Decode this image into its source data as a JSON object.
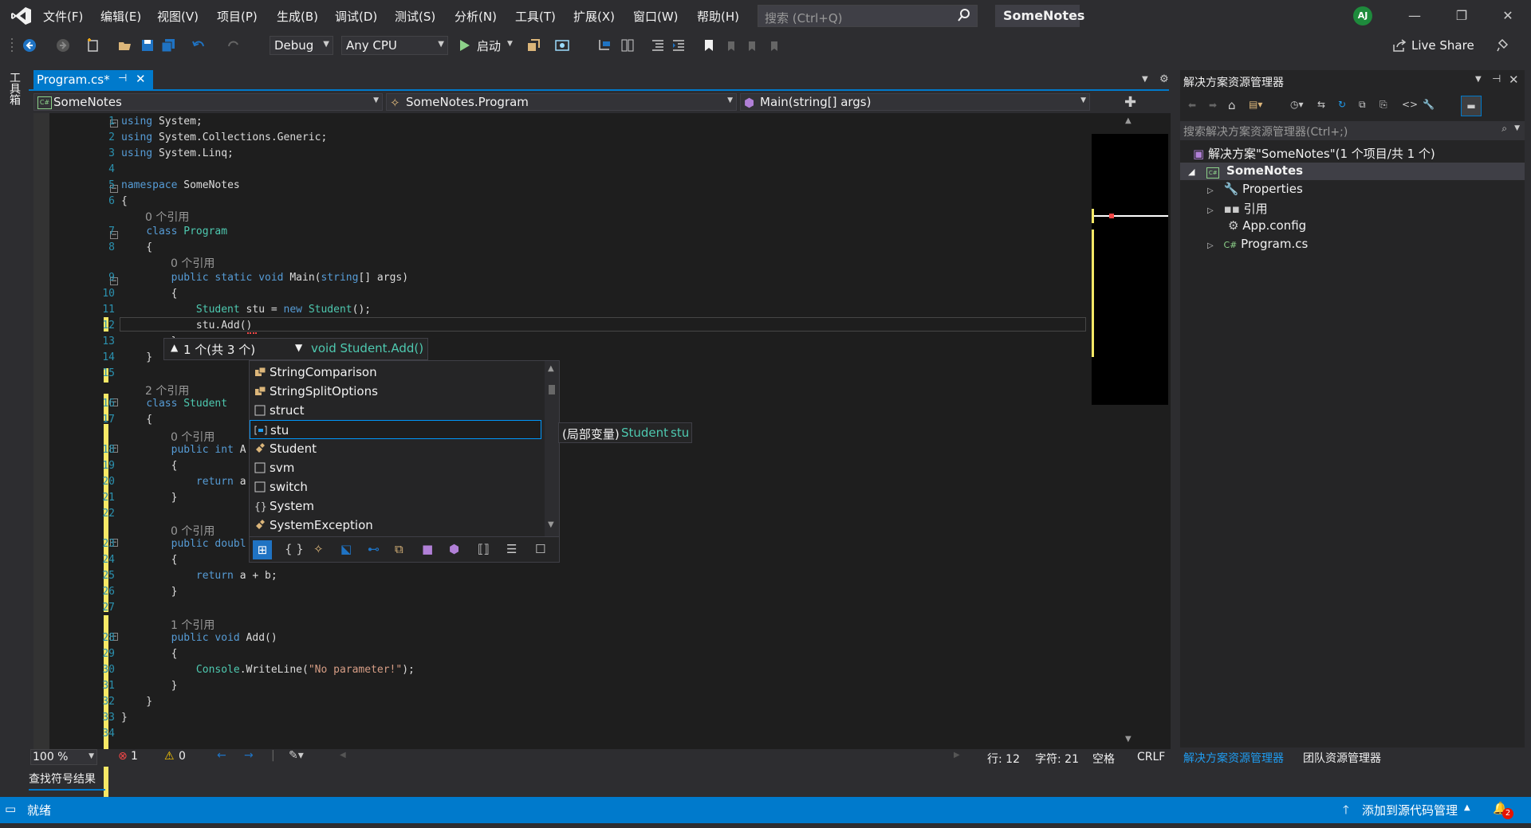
{
  "menu": [
    "文件(F)",
    "编辑(E)",
    "视图(V)",
    "项目(P)",
    "生成(B)",
    "调试(D)",
    "测试(S)",
    "分析(N)",
    "工具(T)",
    "扩展(X)",
    "窗口(W)",
    "帮助(H)"
  ],
  "search": {
    "placeholder": "搜索 (Ctrl+Q)"
  },
  "app_title": "SomeNotes",
  "avatar_initials": "AJ",
  "toolbar": {
    "config": "Debug",
    "platform": "Any CPU",
    "start_label": "启动",
    "live_share": "Live Share"
  },
  "toolbox_label": "工具箱",
  "tab": {
    "label": "Program.cs*"
  },
  "nav": {
    "project": "SomeNotes",
    "class": "SomeNotes.Program",
    "member": "Main(string[] args)"
  },
  "code_lines": [
    {
      "n": "1",
      "html": "<span class='kw'>using</span> System;"
    },
    {
      "n": "2",
      "html": "<span class='kw'>using</span> System.Collections.Generic;"
    },
    {
      "n": "3",
      "html": "<span class='kw'>using</span> System.Linq;"
    },
    {
      "n": "4",
      "html": ""
    },
    {
      "n": "5",
      "html": "<span class='kw'>namespace</span> SomeNotes"
    },
    {
      "n": "6",
      "html": "{"
    },
    {
      "n": "7",
      "html": "    <span class='kw'>class</span> <span class='ty'>Program</span>"
    },
    {
      "n": "8",
      "html": "    {"
    },
    {
      "n": "9",
      "html": "        <span class='kw'>public static void</span> Main(<span class='kw'>string</span>[] args)"
    },
    {
      "n": "10",
      "html": "        {"
    },
    {
      "n": "11",
      "html": "            <span class='ty'>Student</span> stu = <span class='kw'>new</span> <span class='ty'>Student</span>();"
    },
    {
      "n": "12",
      "html": "            stu.Add()"
    },
    {
      "n": "13",
      "html": "        }"
    },
    {
      "n": "14",
      "html": "    }"
    },
    {
      "n": "15",
      "html": ""
    },
    {
      "n": "16",
      "html": "    <span class='kw'>class</span> <span class='ty'>Student</span>"
    },
    {
      "n": "17",
      "html": "    {"
    },
    {
      "n": "18",
      "html": "        <span class='kw'>public int</span> A"
    },
    {
      "n": "19",
      "html": "        {"
    },
    {
      "n": "20",
      "html": "            <span class='kw'>return</span> a"
    },
    {
      "n": "21",
      "html": "        }"
    },
    {
      "n": "22",
      "html": ""
    },
    {
      "n": "23",
      "html": "        <span class='kw'>public</span> <span class='kw'>doubl</span>"
    },
    {
      "n": "24",
      "html": "        {"
    },
    {
      "n": "25",
      "html": "            <span class='kw'>return</span> a + b;"
    },
    {
      "n": "26",
      "html": "        }"
    },
    {
      "n": "27",
      "html": ""
    },
    {
      "n": "28",
      "html": "        <span class='kw'>public void</span> Add()"
    },
    {
      "n": "29",
      "html": "        {"
    },
    {
      "n": "30",
      "html": "            <span class='ty'>Console</span>.WriteLine(<span class='st'>\"No parameter!\"</span>);"
    },
    {
      "n": "31",
      "html": "        }"
    },
    {
      "n": "32",
      "html": "    }"
    },
    {
      "n": "33",
      "html": "}"
    },
    {
      "n": "34",
      "html": ""
    }
  ],
  "codelens": [
    "0 个引用",
    "0 个引用",
    "2 个引用",
    "0 个引用",
    "0 个引用",
    "1 个引用"
  ],
  "param_info": {
    "counter": "1 个(共 3 个)",
    "signature": "void Student.Add()"
  },
  "completion": {
    "items": [
      {
        "label": "StringComparison",
        "icon": "enum"
      },
      {
        "label": "StringSplitOptions",
        "icon": "enum"
      },
      {
        "label": "struct",
        "icon": "snippet"
      },
      {
        "label": "stu",
        "icon": "local",
        "selected": true
      },
      {
        "label": "Student",
        "icon": "class"
      },
      {
        "label": "svm",
        "icon": "snippet"
      },
      {
        "label": "switch",
        "icon": "snippet"
      },
      {
        "label": "System",
        "icon": "namespace"
      },
      {
        "label": "SystemException",
        "icon": "class"
      }
    ]
  },
  "quick_info": {
    "prefix": "(局部变量)",
    "type": "Student",
    "name": "stu"
  },
  "editor_status": {
    "zoom": "100 %",
    "errors": "1",
    "warnings": "0",
    "line": "行: 12",
    "char": "字符: 21",
    "spaces": "空格",
    "eol": "CRLF"
  },
  "find_results": "查找符号结果",
  "status": {
    "ready": "就绪",
    "source_control": "添加到源代码管理",
    "notifications": "2"
  },
  "solution_explorer": {
    "title": "解决方案资源管理器",
    "search_placeholder": "搜索解决方案资源管理器(Ctrl+;)",
    "solution": "解决方案\"SomeNotes\"(1 个项目/共 1 个)",
    "project": "SomeNotes",
    "items": [
      "Properties",
      "引用",
      "App.config",
      "Program.cs"
    ],
    "tabs": [
      "解决方案资源管理器",
      "团队资源管理器"
    ]
  },
  "colors": {
    "accent": "#007acc",
    "keyword": "#569cd6",
    "type": "#4ec9b0",
    "string": "#d69d85"
  }
}
